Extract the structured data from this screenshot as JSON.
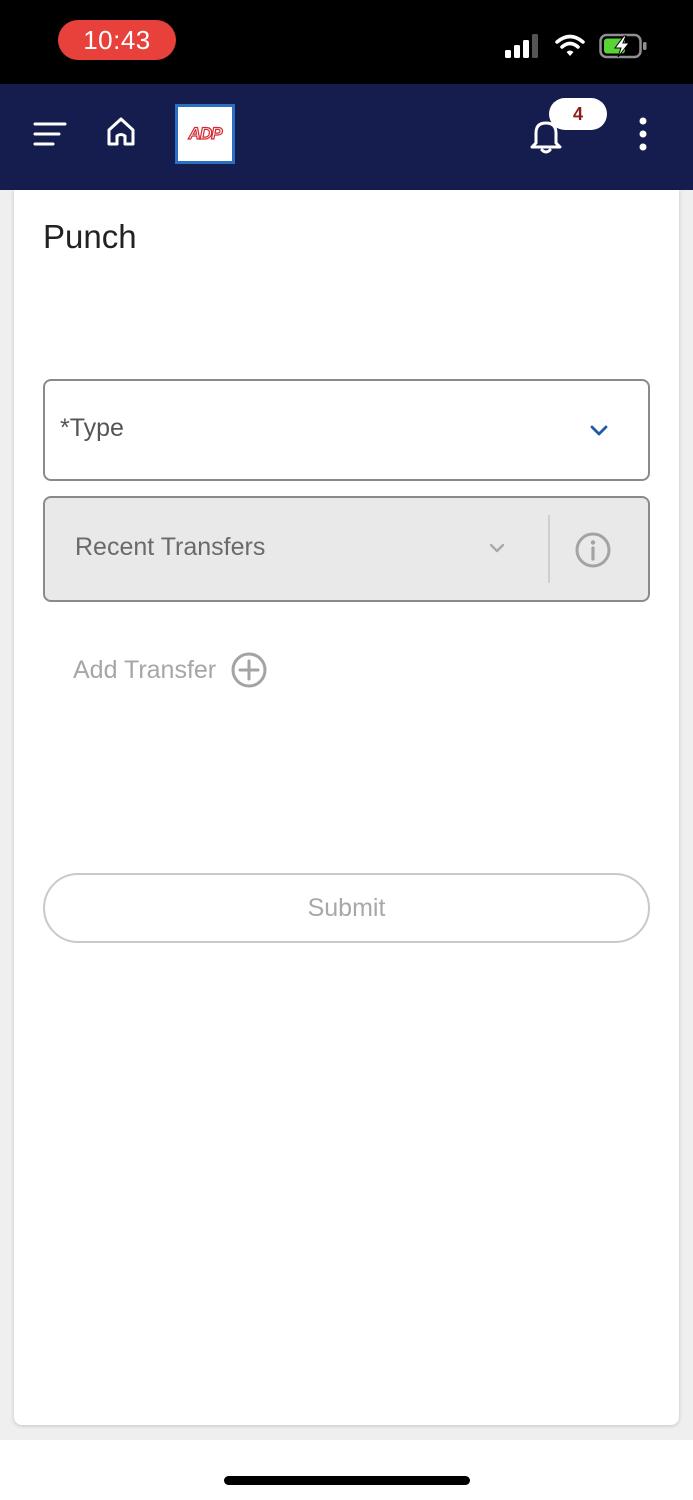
{
  "status_bar": {
    "time": "10:43",
    "time_pill_color": "#e8403a",
    "icons": [
      "cellular-signal-icon",
      "wifi-icon",
      "battery-charging-icon"
    ]
  },
  "header": {
    "background": "#151d4f",
    "logo_text": "ADP",
    "notification_count": "4",
    "icons": [
      "menu-icon",
      "home-icon",
      "bell-icon",
      "more-vertical-icon"
    ]
  },
  "page": {
    "title": "Punch",
    "type_field": {
      "label": "*Type",
      "value": ""
    },
    "recent_transfers": {
      "label": "Recent Transfers"
    },
    "add_transfer_label": "Add Transfer",
    "submit_label": "Submit"
  }
}
